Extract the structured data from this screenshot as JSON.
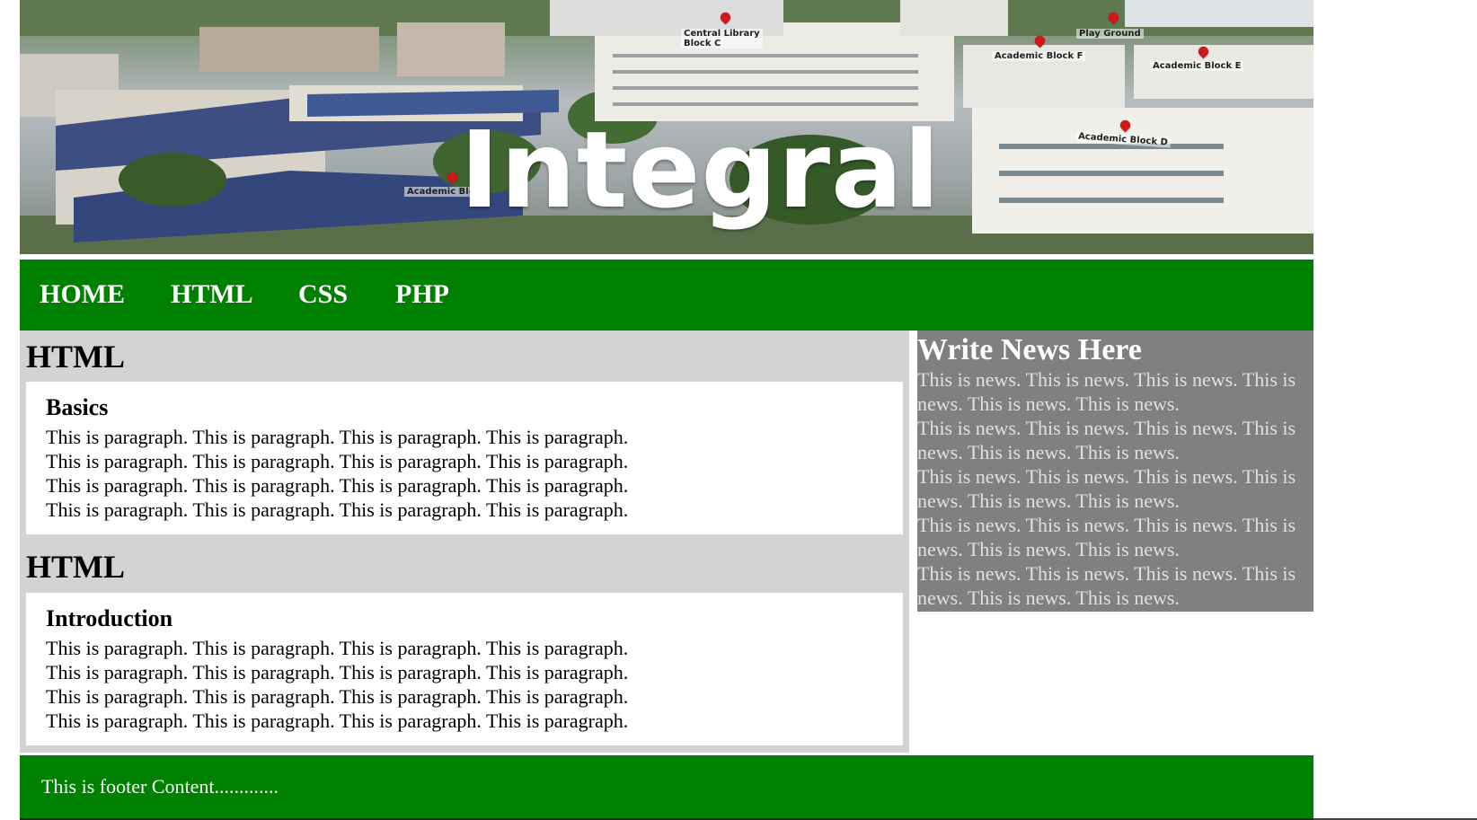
{
  "banner": {
    "title": "Integral",
    "pins": [
      {
        "label": "Central Library",
        "sub": "Block C"
      },
      {
        "label": "Play Ground"
      },
      {
        "label": "Academic Block F"
      },
      {
        "label": "Academic Block E"
      },
      {
        "label": "Academic Block D"
      },
      {
        "label": "Academic Bloc"
      }
    ]
  },
  "nav": {
    "items": [
      "HOME",
      "HTML",
      "CSS",
      "PHP"
    ]
  },
  "main": {
    "sections": [
      {
        "title": "HTML",
        "card_heading": "Basics",
        "lines": [
          "This is paragraph. This is paragraph. This is paragraph. This is paragraph.",
          "This is paragraph. This is paragraph. This is paragraph. This is paragraph.",
          "This is paragraph. This is paragraph. This is paragraph. This is paragraph.",
          "This is paragraph. This is paragraph. This is paragraph. This is paragraph."
        ]
      },
      {
        "title": "HTML",
        "card_heading": "Introduction",
        "lines": [
          "This is paragraph. This is paragraph. This is paragraph. This is paragraph.",
          "This is paragraph. This is paragraph. This is paragraph. This is paragraph.",
          "This is paragraph. This is paragraph. This is paragraph. This is paragraph.",
          "This is paragraph. This is paragraph. This is paragraph. This is paragraph."
        ]
      }
    ]
  },
  "sidebar": {
    "heading": "Write News Here",
    "items": [
      "This is news. This is news. This is news. This is news. This is news. This is news.",
      "This is news. This is news. This is news. This is news. This is news. This is news.",
      "This is news. This is news. This is news. This is news. This is news. This is news.",
      "This is news. This is news. This is news. This is news. This is news. This is news.",
      "This is news. This is news. This is news. This is news. This is news. This is news."
    ]
  },
  "footer": {
    "text": "This is footer Content............."
  },
  "colors": {
    "nav_bg": "#008000",
    "main_bg": "#d3d3d3",
    "sidebar_bg": "#808080",
    "card_bg": "#ffffff"
  }
}
